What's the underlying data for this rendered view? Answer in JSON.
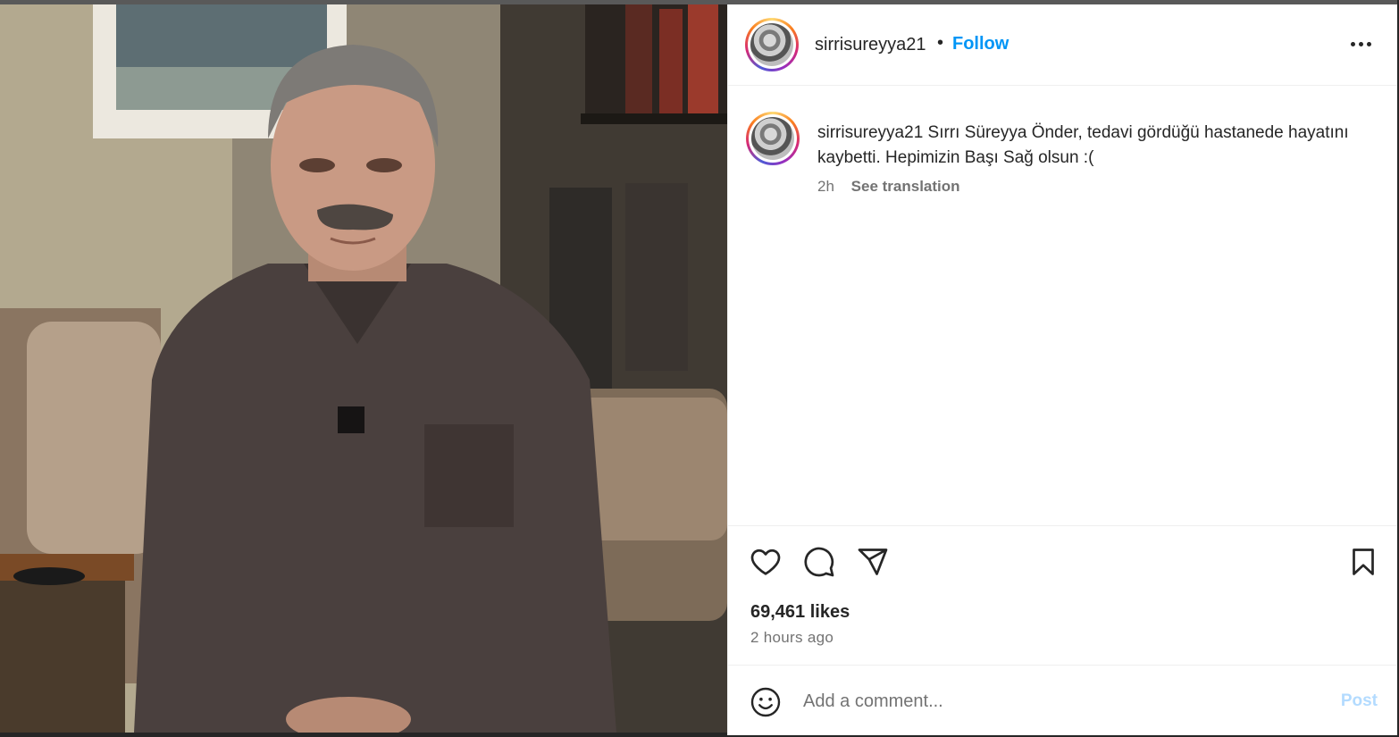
{
  "photo": {
    "alt": "Photo of a smiling man with grey hair and moustache in a dark polo shirt, seated in a living room"
  },
  "header": {
    "username": "sirrisureyya21",
    "separator": "•",
    "follow_label": "Follow",
    "more_icon": "more-horizontal-icon"
  },
  "caption": {
    "username": "sirrisureyya21",
    "text": "Sırrı Süreyya Önder, tedavi gördüğü hastanede hayatını kaybetti. Hepimizin Başı Sağ olsun :(",
    "time": "2h",
    "translate_label": "See translation"
  },
  "actions": {
    "like_icon": "heart-icon",
    "comment_icon": "comment-icon",
    "share_icon": "share-icon",
    "save_icon": "bookmark-icon"
  },
  "stats": {
    "likes": "69,461 likes",
    "posted": "2 hours ago"
  },
  "comment": {
    "placeholder": "Add a comment...",
    "post_label": "Post",
    "emoji_icon": "emoji-icon"
  },
  "colors": {
    "accent": "#0095f6",
    "post_disabled": "#b3dbff",
    "text": "#262626",
    "muted": "#737373"
  }
}
